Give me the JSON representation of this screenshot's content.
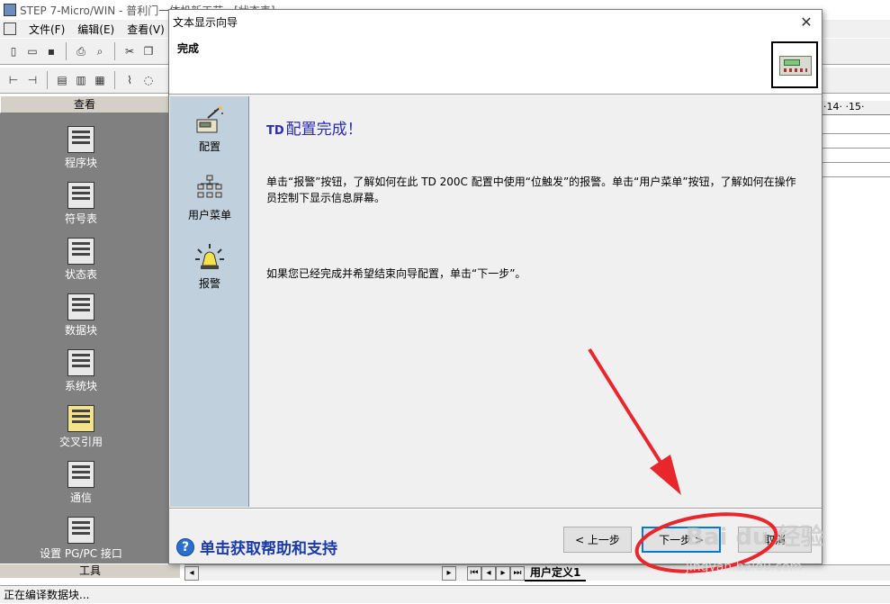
{
  "app": {
    "title": "STEP 7-Micro/WIN - 普利门一体机新工艺 - [状态表]"
  },
  "menubar": {
    "items": [
      "文件(F)",
      "编辑(E)",
      "查看(V)"
    ]
  },
  "nav": {
    "header": "查看",
    "items": [
      {
        "label": "程序块",
        "icon": "program-block-icon"
      },
      {
        "label": "符号表",
        "icon": "symbol-table-icon"
      },
      {
        "label": "状态表",
        "icon": "status-table-icon"
      },
      {
        "label": "数据块",
        "icon": "data-block-icon"
      },
      {
        "label": "系统块",
        "icon": "system-block-icon"
      },
      {
        "label": "交叉引用",
        "icon": "cross-reference-icon"
      },
      {
        "label": "通信",
        "icon": "communication-icon"
      },
      {
        "label": "设置 PG/PC 接口",
        "icon": "pg-pc-interface-icon"
      }
    ],
    "footer": "工具"
  },
  "editor": {
    "ruler_text": "·14· ·15·",
    "sheet_tab": "用户定义1"
  },
  "status_bar": {
    "text": "正在编译数据块..."
  },
  "dialog": {
    "title": "文本显示向导",
    "header_title": "完成",
    "sidebar": [
      {
        "label": "配置",
        "icon": "configure-wand-icon"
      },
      {
        "label": "用户菜单",
        "icon": "menu-tree-icon"
      },
      {
        "label": "报警",
        "icon": "alarm-light-icon"
      }
    ],
    "content": {
      "title_prefix": "TD",
      "title": "配置完成！",
      "para1": "单击“报警”按钮，了解如何在此 TD 200C 配置中使用“位触发”的报警。单击“用户菜单”按钮，了解如何在操作员控制下显示信息屏幕。",
      "para2": "如果您已经完成并希望结束向导配置，单击“下一步”。"
    },
    "help_link": "单击获取帮助和支持",
    "buttons": {
      "prev": "< 上一步",
      "next": "下一步 >",
      "cancel": "取消"
    }
  },
  "watermark": {
    "brand": "Bai du 经验",
    "url": "jingyan.baidu.com"
  },
  "colors": {
    "annotation_red": "#e8262b",
    "title_blue": "#2a2ab8",
    "sidebar_bg": "#c0d0dc"
  }
}
